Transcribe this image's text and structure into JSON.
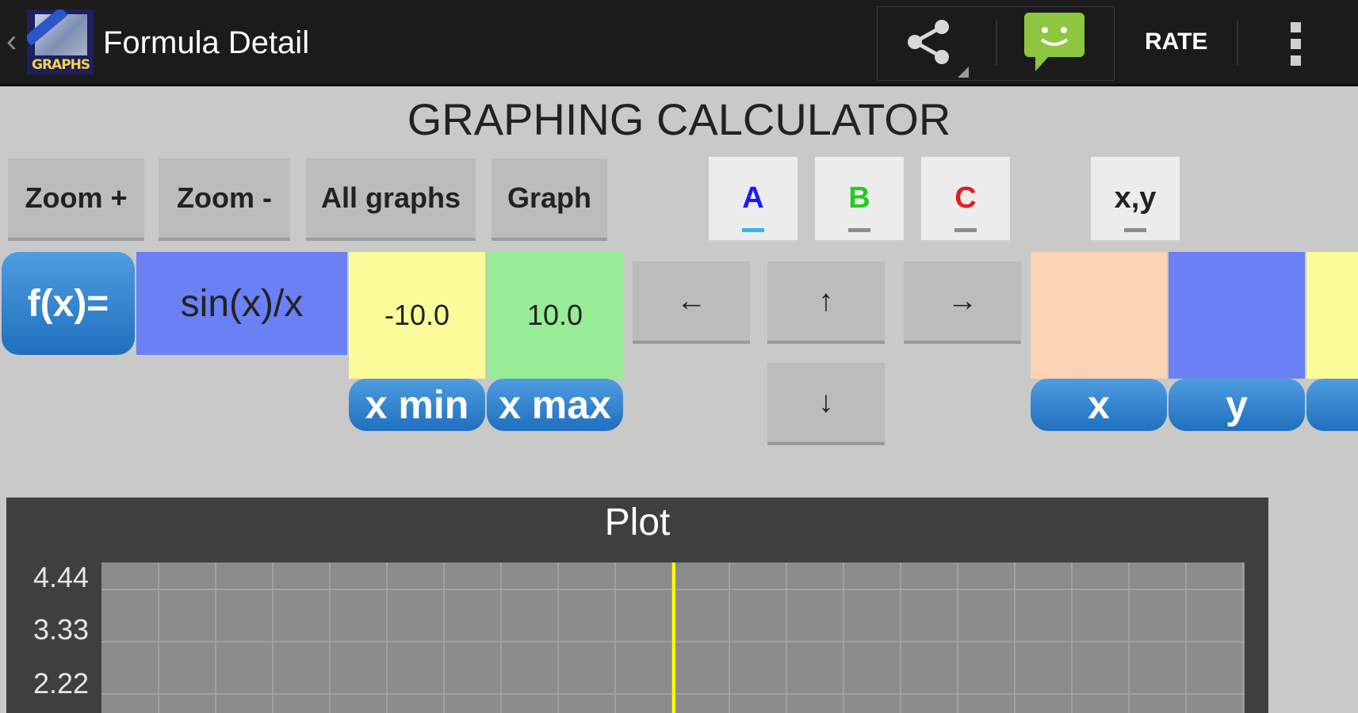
{
  "actionbar": {
    "title": "Formula Detail",
    "logo_text": "GRAPHS",
    "rate_label": "RATE",
    "icons": [
      "back-chevron-icon",
      "share-icon",
      "message-icon",
      "overflow-menu-icon"
    ]
  },
  "page_title": "GRAPHING CALCULATOR",
  "toolbar": {
    "zoom_in": "Zoom +",
    "zoom_out": "Zoom -",
    "all_graphs": "All graphs",
    "graph": "Graph"
  },
  "tabs": [
    {
      "label": "A",
      "color": "#1a1aff"
    },
    {
      "label": "B",
      "color": "#22cc22"
    },
    {
      "label": "C",
      "color": "#e02020"
    },
    {
      "label": "x,y",
      "color": "#222222"
    }
  ],
  "formula": {
    "label": "f(x)=",
    "expression": "sin(x)/x",
    "xmin_value": "-10.0",
    "xmax_value": "10.0",
    "xmin_label": "x min",
    "xmax_label": "x max"
  },
  "arrows": {
    "left": "←",
    "up": "↑",
    "right": "→",
    "down": "↓"
  },
  "coords": {
    "x_label": "x",
    "y_label": "y"
  },
  "colors": {
    "expression_bg": "#6b80f2",
    "xmin_bg": "#fbfb9a",
    "xmax_bg": "#98ec95",
    "x_bg": "#fdd3b5",
    "y_bg": "#6b80f2"
  },
  "plot": {
    "title": "Plot",
    "y_ticks": [
      "4.44",
      "3.33",
      "2.22"
    ]
  }
}
